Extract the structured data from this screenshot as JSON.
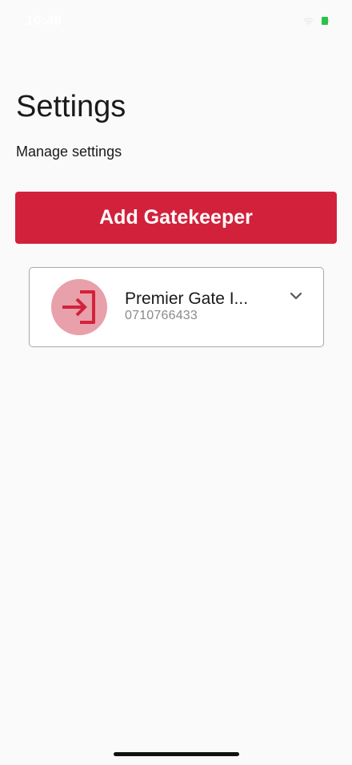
{
  "status_bar": {
    "time": "10:49",
    "wifi_icon": "wifi-icon",
    "battery_icon": "battery-icon",
    "battery_color": "#2bc24a"
  },
  "header": {
    "title": "Settings",
    "subtitle": "Manage settings"
  },
  "actions": {
    "add_gatekeeper_label": "Add Gatekeeper",
    "accent_color": "#d2223b"
  },
  "gatekeepers": [
    {
      "name": "Premier Gate I...",
      "phone": "0710766433",
      "icon": "login-icon",
      "expand_icon": "chevron-down-icon"
    }
  ]
}
